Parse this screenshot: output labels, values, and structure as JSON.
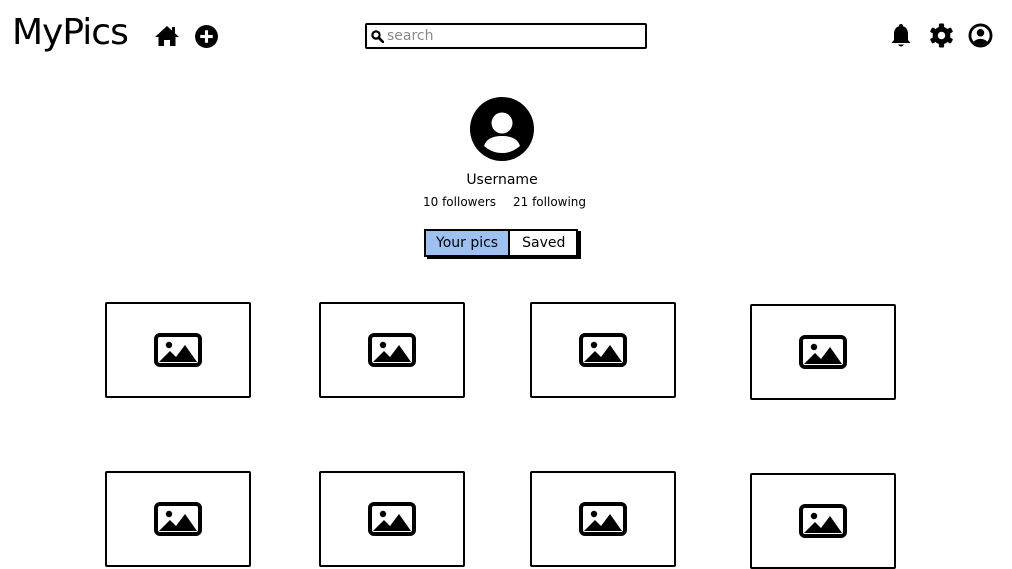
{
  "header": {
    "logo": "MyPics",
    "search": {
      "placeholder": "search",
      "value": ""
    },
    "icons": [
      "home-icon",
      "add-icon",
      "search-icon",
      "bell-icon",
      "gear-icon",
      "user-icon"
    ]
  },
  "profile": {
    "username": "Username",
    "followers": "10 followers",
    "following": "21 following"
  },
  "tabs": [
    {
      "label": "Your pics",
      "active": true
    },
    {
      "label": "Saved",
      "active": false
    }
  ],
  "colors": {
    "active_tab": "#9ec1f1",
    "ink": "#000000",
    "placeholder": "#8a8a8a"
  },
  "gallery": {
    "item_icon": "image-placeholder-icon",
    "visible_items": 8
  }
}
